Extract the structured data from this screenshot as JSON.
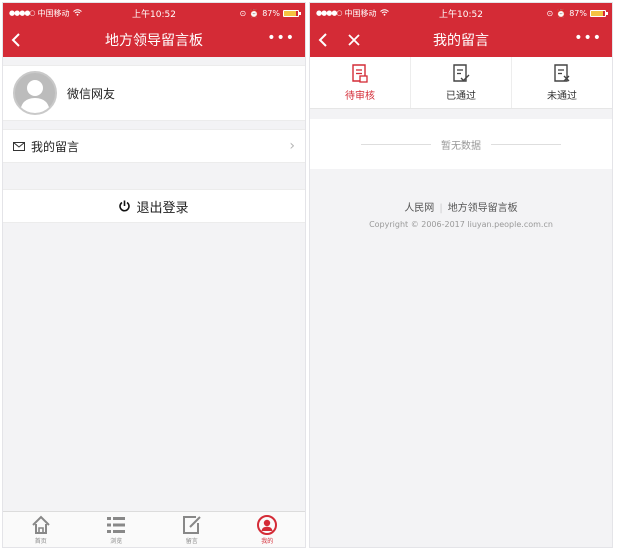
{
  "colors": {
    "brand": "#d42b36",
    "battery": "#f5c342"
  },
  "status_bar": {
    "carrier": "中国移动",
    "time": "上午10:52",
    "battery": "87%"
  },
  "left_screen": {
    "title": "地方领导留言板",
    "profile_name": "微信网友",
    "my_messages_label": "我的留言",
    "logout_label": "退出登录",
    "tabs": [
      {
        "label": "首页",
        "icon": "home-icon"
      },
      {
        "label": "浏览",
        "icon": "list-icon"
      },
      {
        "label": "留言",
        "icon": "edit-icon"
      },
      {
        "label": "我的",
        "icon": "user-icon",
        "active": true
      }
    ]
  },
  "right_screen": {
    "title": "我的留言",
    "segments": [
      {
        "label": "待审核",
        "icon": "pending-doc-icon",
        "active": true
      },
      {
        "label": "已通过",
        "icon": "approved-doc-icon"
      },
      {
        "label": "未通过",
        "icon": "rejected-doc-icon"
      }
    ],
    "empty_text": "暂无数据",
    "footer_link_1": "人民网",
    "footer_link_2": "地方领导留言板",
    "copyright": "Copyright © 2006-2017 liuyan.people.com.cn"
  }
}
